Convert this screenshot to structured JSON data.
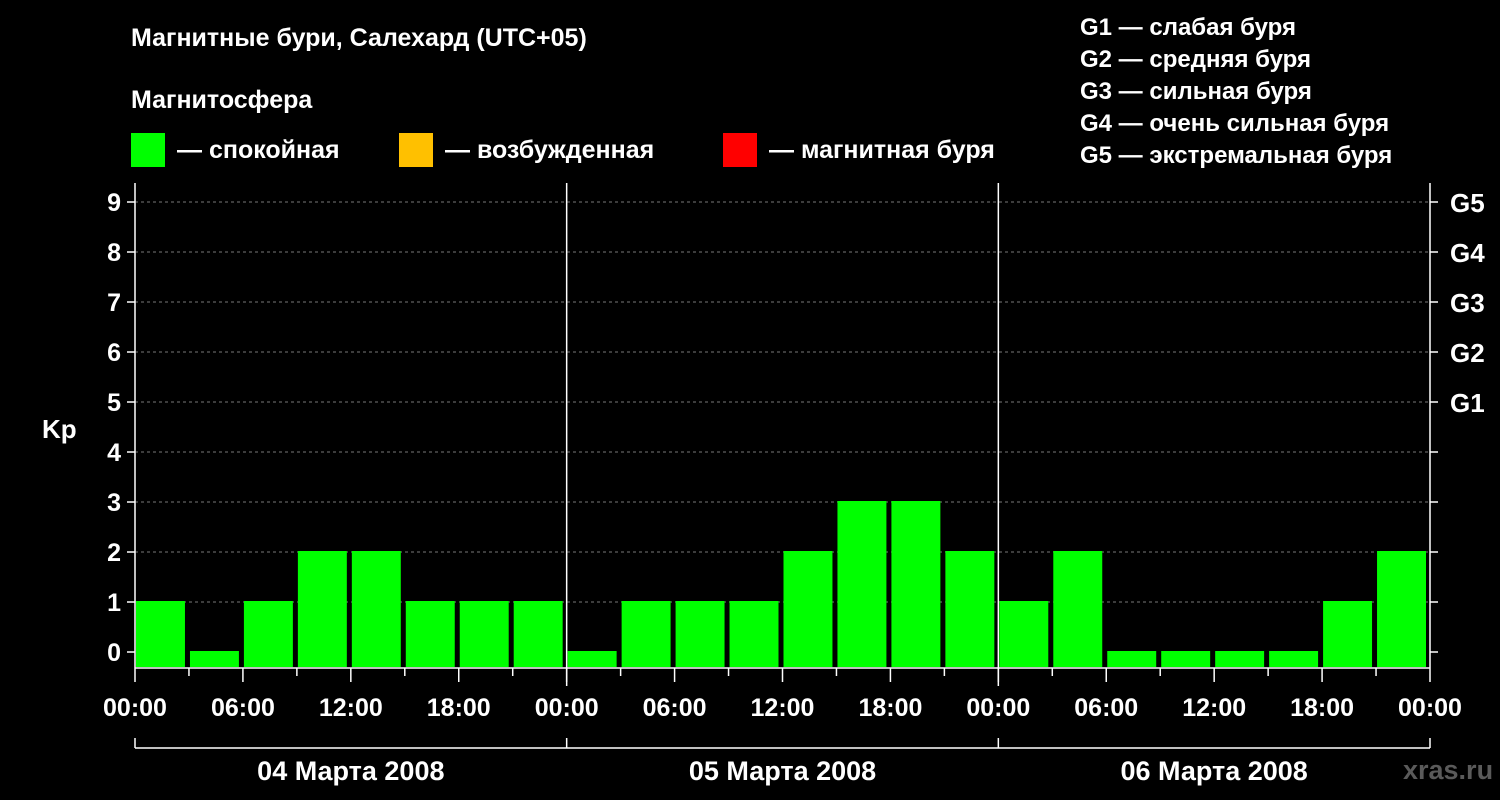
{
  "title": "Магнитные бури, Салехард (UTC+05)",
  "subtitle": "Магнитосфера",
  "legend": [
    {
      "label": "— спокойная",
      "color": "#00ff00"
    },
    {
      "label": "— возбужденная",
      "color": "#ffc000"
    },
    {
      "label": "— магнитная буря",
      "color": "#ff0000"
    }
  ],
  "g_legend": [
    "G1 — слабая буря",
    "G2 — средняя буря",
    "G3 — сильная буря",
    "G4 — очень сильная буря",
    "G5 — экстремальная буря"
  ],
  "watermark": "xras.ru",
  "chart_data": {
    "type": "bar",
    "ylabel": "Kp",
    "ylim": [
      0,
      9
    ],
    "y_ticks": [
      "0",
      "1",
      "2",
      "3",
      "4",
      "5",
      "6",
      "7",
      "8",
      "9"
    ],
    "g_ticks": [
      {
        "value": 5,
        "label": "G1"
      },
      {
        "value": 6,
        "label": "G2"
      },
      {
        "value": 7,
        "label": "G3"
      },
      {
        "value": 8,
        "label": "G4"
      },
      {
        "value": 9,
        "label": "G5"
      }
    ],
    "x_tick_labels": [
      "00:00",
      "06:00",
      "12:00",
      "18:00",
      "00:00",
      "06:00",
      "12:00",
      "18:00",
      "00:00",
      "06:00",
      "12:00",
      "18:00",
      "00:00"
    ],
    "days": [
      "04 Марта 2008",
      "05 Марта 2008",
      "06 Марта 2008"
    ],
    "interval_hours": 3,
    "values": [
      1,
      0,
      1,
      2,
      2,
      1,
      1,
      1,
      0,
      1,
      1,
      1,
      2,
      3,
      3,
      2,
      1,
      2,
      0,
      0,
      0,
      0,
      1,
      2
    ],
    "colors": {
      "quiet": "#00ff00",
      "active": "#ffc000",
      "storm": "#ff0000"
    },
    "grid": true
  }
}
